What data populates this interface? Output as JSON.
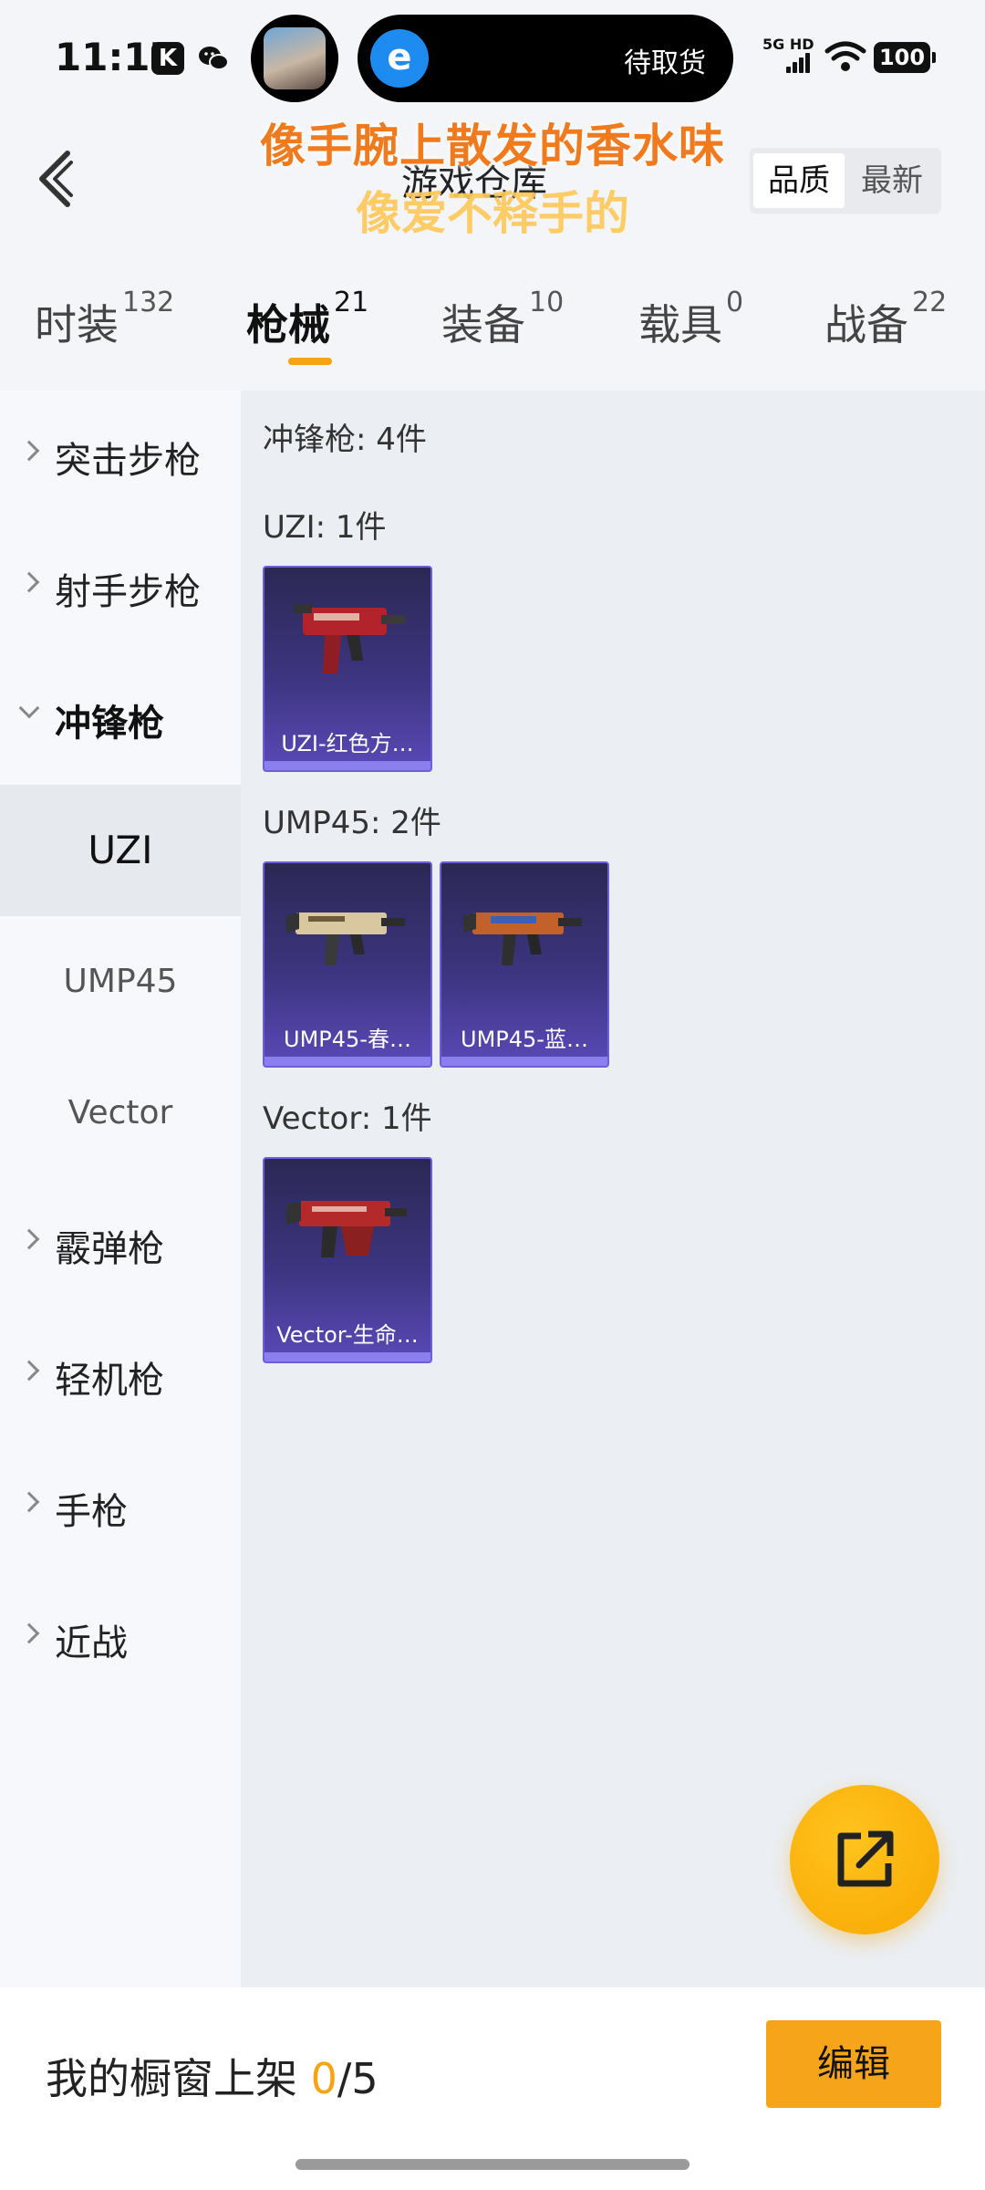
{
  "status_bar": {
    "time": "11:17",
    "left_icons": [
      "k-app-icon",
      "wechat-icon"
    ],
    "island_text": "待取货",
    "network": "5G HD",
    "battery": "100"
  },
  "header": {
    "title": "游戏仓库",
    "lyric_line1": "像手腕上散发的香水味",
    "lyric_line2": "像爱不释手的",
    "sort_options": [
      "品质",
      "最新"
    ]
  },
  "tabs": [
    {
      "label": "时装",
      "count": "132"
    },
    {
      "label": "枪械",
      "count": "21"
    },
    {
      "label": "装备",
      "count": "10"
    },
    {
      "label": "载具",
      "count": "0"
    },
    {
      "label": "战备",
      "count": "22"
    }
  ],
  "sidebar": {
    "categories": [
      "突击步枪",
      "射手步枪",
      "冲锋枪",
      "霰弹枪",
      "轻机枪",
      "手枪",
      "近战"
    ],
    "subitems": [
      "UZI",
      "UMP45",
      "Vector"
    ]
  },
  "content": {
    "summary": "冲锋枪: 4件",
    "groups": [
      {
        "title": "UZI: 1件",
        "items": [
          "UZI-红色方…"
        ]
      },
      {
        "title": "UMP45: 2件",
        "items": [
          "UMP45-春…",
          "UMP45-蓝…"
        ]
      },
      {
        "title": "Vector: 1件",
        "items": [
          "Vector-生命…"
        ]
      }
    ]
  },
  "bottom": {
    "label": "我的橱窗上架",
    "current": "0",
    "total": "/5",
    "edit_label": "编辑"
  },
  "colors": {
    "accent": "#f5a413",
    "lyric_orange": "#f07a1e",
    "card_border": "#6e5fd9"
  }
}
